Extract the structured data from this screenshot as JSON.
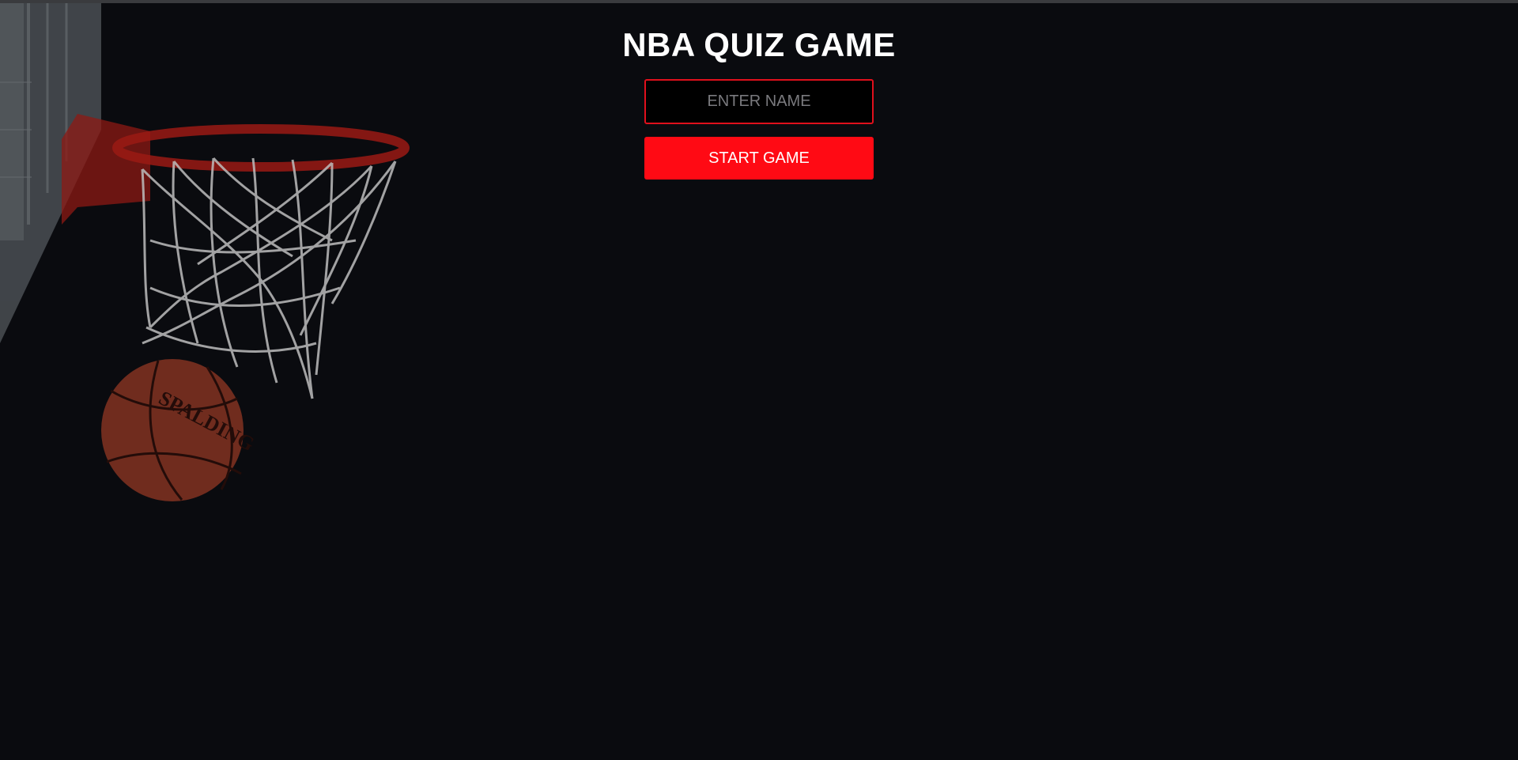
{
  "header": {
    "title": "NBA QUIZ GAME"
  },
  "form": {
    "name_placeholder": "ENTER NAME",
    "name_value": "",
    "start_label": "START GAME"
  },
  "background": {
    "icon": "basketball-hoop-icon",
    "ball_brand": "SPALDING",
    "ball_color": "#8a3522",
    "rim_color": "#9a1a14",
    "net_color": "#bdbdbd"
  },
  "colors": {
    "page_bg": "#0a0b0f",
    "accent": "#ff0a14",
    "input_border": "#e0101c",
    "text": "#ffffff",
    "placeholder": "#7a7a7e"
  }
}
